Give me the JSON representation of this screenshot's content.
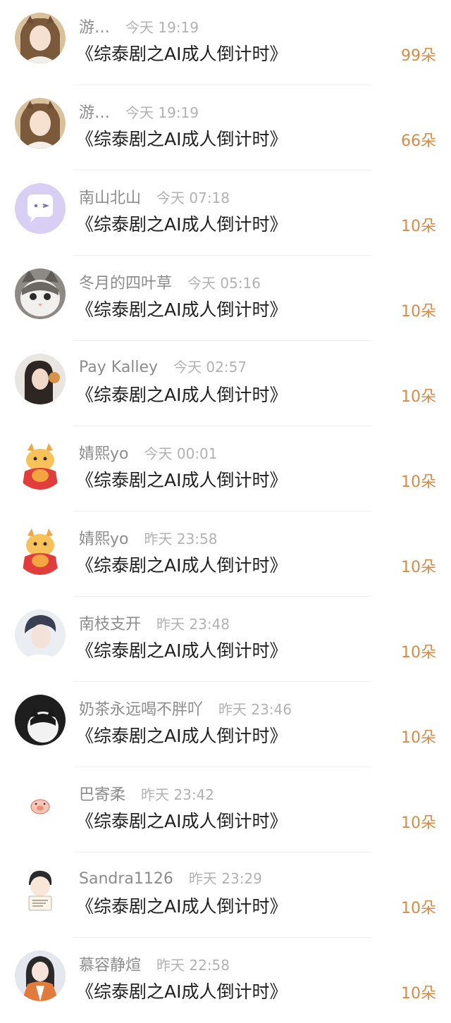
{
  "colors": {
    "name": "#8c8c8c",
    "time": "#b2b2b2",
    "title": "#1f1f1f",
    "gift": "#d98b45",
    "divider": "#efefef"
  },
  "gifts": [
    {
      "name": "游…",
      "time": "今天 19:19",
      "book": "《综泰剧之AI成人倒计时》",
      "amount": "99朵",
      "avatar": "portrait-girl-cat-ears"
    },
    {
      "name": "游…",
      "time": "今天 19:19",
      "book": "《综泰剧之AI成人倒计时》",
      "amount": "66朵",
      "avatar": "portrait-girl-cat-ears"
    },
    {
      "name": "南山北山",
      "time": "今天 07:18",
      "book": "《综泰剧之AI成人倒计时》",
      "amount": "10朵",
      "avatar": "chat-bubble-face-icon"
    },
    {
      "name": "冬月的四叶草",
      "time": "今天 05:16",
      "book": "《综泰剧之AI成人倒计时》",
      "amount": "10朵",
      "avatar": "kitten-photo"
    },
    {
      "name": "Pay Kalley",
      "time": "今天 02:57",
      "book": "《综泰剧之AI成人倒计时》",
      "amount": "10朵",
      "avatar": "girl-photo"
    },
    {
      "name": "婧熙yo",
      "time": "今天 00:01",
      "book": "《综泰剧之AI成人倒计时》",
      "amount": "10朵",
      "avatar": "dragon-sticker"
    },
    {
      "name": "婧熙yo",
      "time": "昨天 23:58",
      "book": "《综泰剧之AI成人倒计时》",
      "amount": "10朵",
      "avatar": "dragon-sticker"
    },
    {
      "name": "南枝支开",
      "time": "昨天 23:48",
      "book": "《综泰剧之AI成人倒计时》",
      "amount": "10朵",
      "avatar": "young-man-photo"
    },
    {
      "name": "奶茶永远喝不胖吖",
      "time": "昨天 23:46",
      "book": "《综泰剧之AI成人倒计时》",
      "amount": "10朵",
      "avatar": "black-white-cat-photo"
    },
    {
      "name": "巴寄柔",
      "time": "昨天 23:42",
      "book": "《综泰剧之AI成人倒计时》",
      "amount": "10朵",
      "avatar": "pig-face-sticker"
    },
    {
      "name": "Sandra1126",
      "time": "昨天 23:29",
      "book": "《综泰剧之AI成人倒计时》",
      "amount": "10朵",
      "avatar": "cartoon-boy-sign"
    },
    {
      "name": "慕容静煊",
      "time": "昨天 22:58",
      "book": "《综泰剧之AI成人倒计时》",
      "amount": "10朵",
      "avatar": "girl-hanfu-photo"
    }
  ]
}
